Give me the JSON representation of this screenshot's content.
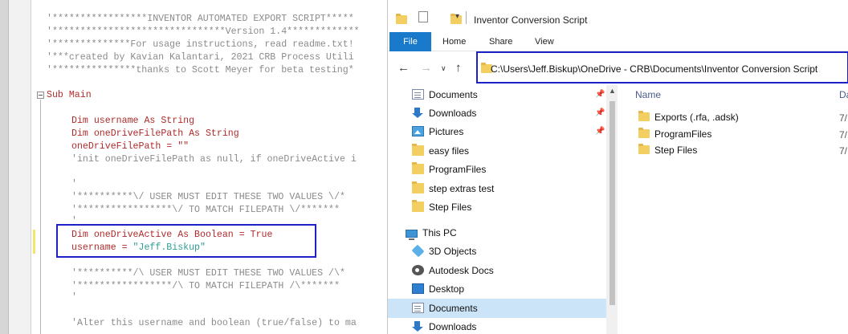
{
  "editor": {
    "lines": [
      {
        "text": "'*****************INVENTOR AUTOMATED EXPORT SCRIPT*****",
        "style": "comment"
      },
      {
        "text": "'*******************************Version 1.4*************",
        "style": "comment"
      },
      {
        "text": "'**************For usage instructions, read readme.txt!",
        "style": "comment"
      },
      {
        "text": "'***created by Kavian Kalantari, 2021 CRB Process Utili",
        "style": "comment"
      },
      {
        "text": "'***************thanks to Scott Meyer for beta testing*",
        "style": "comment"
      },
      {
        "text": "Sub Main",
        "style": "kw"
      },
      {
        "text": "Dim username As String",
        "style": "kw"
      },
      {
        "text": "Dim oneDriveFilePath As String",
        "style": "kw"
      },
      {
        "text": "oneDriveFilePath = \"\"",
        "style": "kw"
      },
      {
        "text": "'init oneDriveFilePath as null, if oneDriveActive i",
        "style": "comment"
      },
      {
        "text": "'",
        "style": "comment"
      },
      {
        "text": "'**********\\/ USER MUST EDIT THESE TWO VALUES \\/*",
        "style": "comment"
      },
      {
        "text": "'*****************\\/ TO MATCH FILEPATH \\/*******",
        "style": "comment"
      },
      {
        "text": "'",
        "style": "comment"
      },
      {
        "text": "Dim oneDriveActive As Boolean = True",
        "style": "kw"
      },
      {
        "text": "username = ",
        "style": "kw",
        "tail": "\"Jeff.Biskup\""
      },
      {
        "text": "'**********/\\ USER MUST EDIT THESE TWO VALUES /\\*",
        "style": "comment"
      },
      {
        "text": "'*****************/\\ TO MATCH FILEPATH /\\*******",
        "style": "comment"
      },
      {
        "text": "'",
        "style": "comment"
      },
      {
        "text": "'Alter this username and boolean (true/false) to ma",
        "style": "comment"
      }
    ]
  },
  "explorer": {
    "title": "Inventor Conversion Script",
    "tabs": [
      "File",
      "Home",
      "Share",
      "View"
    ],
    "address": "C:\\Users\\Jeff.Biskup\\OneDrive - CRB\\Documents\\Inventor Conversion Script",
    "nav_items": [
      {
        "label": "Documents",
        "icon": "document-icon",
        "pinned": true
      },
      {
        "label": "Downloads",
        "icon": "download-icon",
        "pinned": true
      },
      {
        "label": "Pictures",
        "icon": "picture-icon",
        "pinned": true
      },
      {
        "label": "easy files",
        "icon": "folder-icon"
      },
      {
        "label": "ProgramFiles",
        "icon": "folder-icon"
      },
      {
        "label": "step extras test",
        "icon": "folder-icon"
      },
      {
        "label": "Step Files",
        "icon": "folder-icon"
      },
      {
        "label": "This PC",
        "icon": "pc-icon"
      },
      {
        "label": "3D Objects",
        "icon": "3d-objects-icon"
      },
      {
        "label": "Autodesk Docs",
        "icon": "autodesk-icon"
      },
      {
        "label": "Desktop",
        "icon": "desktop-icon"
      },
      {
        "label": "Documents",
        "icon": "document-icon",
        "selected": true
      },
      {
        "label": "Downloads",
        "icon": "download-icon"
      }
    ],
    "columns": {
      "name": "Name",
      "date": "Da"
    },
    "files": [
      {
        "name": "Exports (.rfa, .adsk)",
        "date": "7/"
      },
      {
        "name": "ProgramFiles",
        "date": "7/"
      },
      {
        "name": "Step Files",
        "date": "7/"
      }
    ]
  }
}
